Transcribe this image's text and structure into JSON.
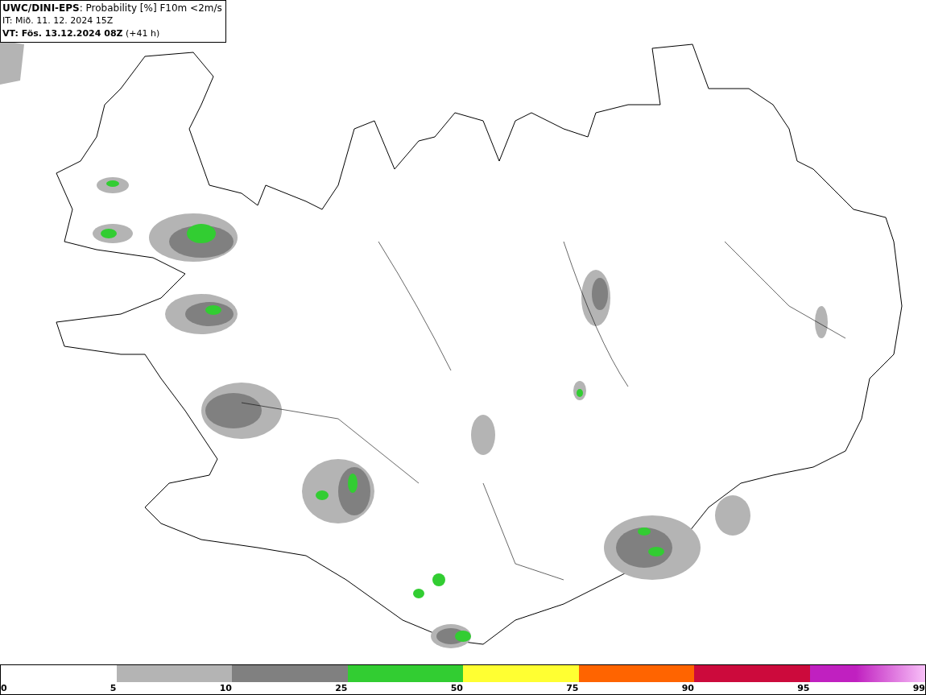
{
  "title_box": {
    "lines": [
      "**UWC/DINI-EPS**: Probability [%] F10m <2m/s",
      "IT: Mið. 11. 12. 2024 15Z",
      "**VT: Fös. 13.12.2024 08Z** (+41 h)"
    ]
  },
  "legend": {
    "segments": [
      {
        "kind": "blank"
      },
      {
        "color": "#b4b4b4"
      },
      {
        "color": "#808080"
      },
      {
        "color": "#32cd32"
      },
      {
        "color": "#ffff32"
      },
      {
        "color": "#ff6400"
      },
      {
        "color": "#cc0a3c"
      },
      {
        "kind": "gradient",
        "color": "#c020c0"
      }
    ],
    "ticks": [
      "0",
      "5",
      "10",
      "25",
      "50",
      "75",
      "90",
      "95",
      "99"
    ]
  }
}
